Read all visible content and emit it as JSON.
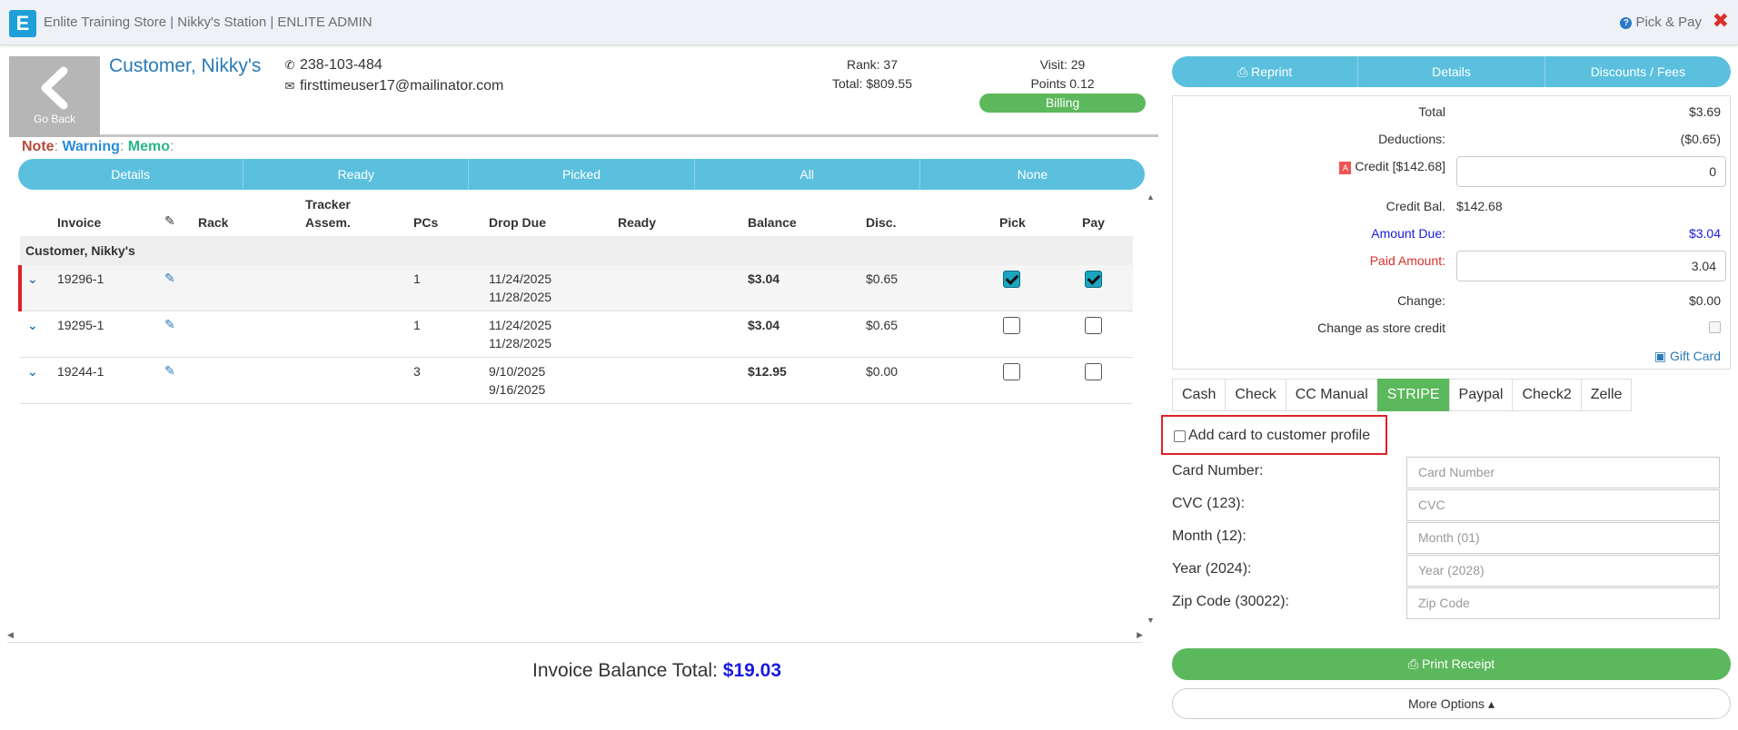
{
  "topbar": {
    "logo_letter": "E",
    "title": "Enlite Training Store | Nikky's Station | ENLITE ADMIN",
    "pick_pay": "Pick & Pay",
    "close_icon": "✖"
  },
  "customer": {
    "go_back": "Go Back",
    "name": "Customer, Nikky's",
    "phone": "238-103-484",
    "email": "firsttimeuser17@mailinator.com",
    "rank": "Rank: 37",
    "total": "Total: $809.55",
    "visit": "Visit: 29",
    "points": "Points 0.12",
    "billing": "Billing"
  },
  "notes": {
    "note": "Note",
    "warning": "Warning",
    "memo": "Memo",
    "sep": ":"
  },
  "filters": [
    "Details",
    "Ready",
    "Picked",
    "All",
    "None"
  ],
  "table": {
    "headers": {
      "invoice": "Invoice",
      "rack": "Rack",
      "tracker1": "Tracker",
      "tracker2": "Assem.",
      "pcs": "PCs",
      "drop_due": "Drop Due",
      "ready": "Ready",
      "balance": "Balance",
      "disc": "Disc.",
      "pick": "Pick",
      "pay": "Pay"
    },
    "group": "Customer, Nikky's",
    "rows": [
      {
        "invoice": "19296-1",
        "pcs": "1",
        "drop": "11/24/2025",
        "due": "11/28/2025",
        "balance": "$3.04",
        "disc": "$0.65",
        "pick": true,
        "pay": true,
        "selected": true
      },
      {
        "invoice": "19295-1",
        "pcs": "1",
        "drop": "11/24/2025",
        "due": "11/28/2025",
        "balance": "$3.04",
        "disc": "$0.65",
        "pick": false,
        "pay": false,
        "selected": false
      },
      {
        "invoice": "19244-1",
        "pcs": "3",
        "drop": "9/10/2025",
        "due": "9/16/2025",
        "balance": "$12.95",
        "disc": "$0.00",
        "pick": false,
        "pay": false,
        "selected": false
      }
    ]
  },
  "invoice_total": {
    "label": "Invoice Balance Total:",
    "amount": "$19.03"
  },
  "right_tabs": {
    "reprint": "Reprint",
    "details": "Details",
    "discounts": "Discounts / Fees"
  },
  "summary": {
    "total_label": "Total",
    "total_value": "$3.69",
    "deductions_label": "Deductions:",
    "deductions_value": "($0.65)",
    "credit_label": "Credit [$142.68]",
    "credit_input": "0",
    "credit_bal_label": "Credit Bal.",
    "credit_bal_value": "$142.68",
    "amount_due_label": "Amount Due:",
    "amount_due_value": "$3.04",
    "paid_label": "Paid Amount:",
    "paid_input": "3.04",
    "change_label": "Change:",
    "change_value": "$0.00",
    "store_credit_label": "Change as store credit",
    "gift_card": "Gift Card"
  },
  "pay_methods": [
    "Cash",
    "Check",
    "CC Manual",
    "STRIPE",
    "Paypal",
    "Check2",
    "Zelle"
  ],
  "pay_active": "STRIPE",
  "card_form": {
    "add_card_label": "Add card to customer profile",
    "card_number_label": "Card Number:",
    "card_number_ph": "Card Number",
    "cvc_label": "CVC (123):",
    "cvc_ph": "CVC",
    "month_label": "Month (12):",
    "month_ph": "Month (01)",
    "year_label": "Year (2024):",
    "year_ph": "Year (2028)",
    "zip_label": "Zip Code (30022):",
    "zip_ph": "Zip Code"
  },
  "buttons": {
    "print_receipt": "Print Receipt",
    "more_options": "More Options"
  },
  "colors": {
    "accent": "#5bc0de",
    "success": "#5cb85c",
    "link": "#2a7ab8",
    "danger": "#e0202a"
  }
}
